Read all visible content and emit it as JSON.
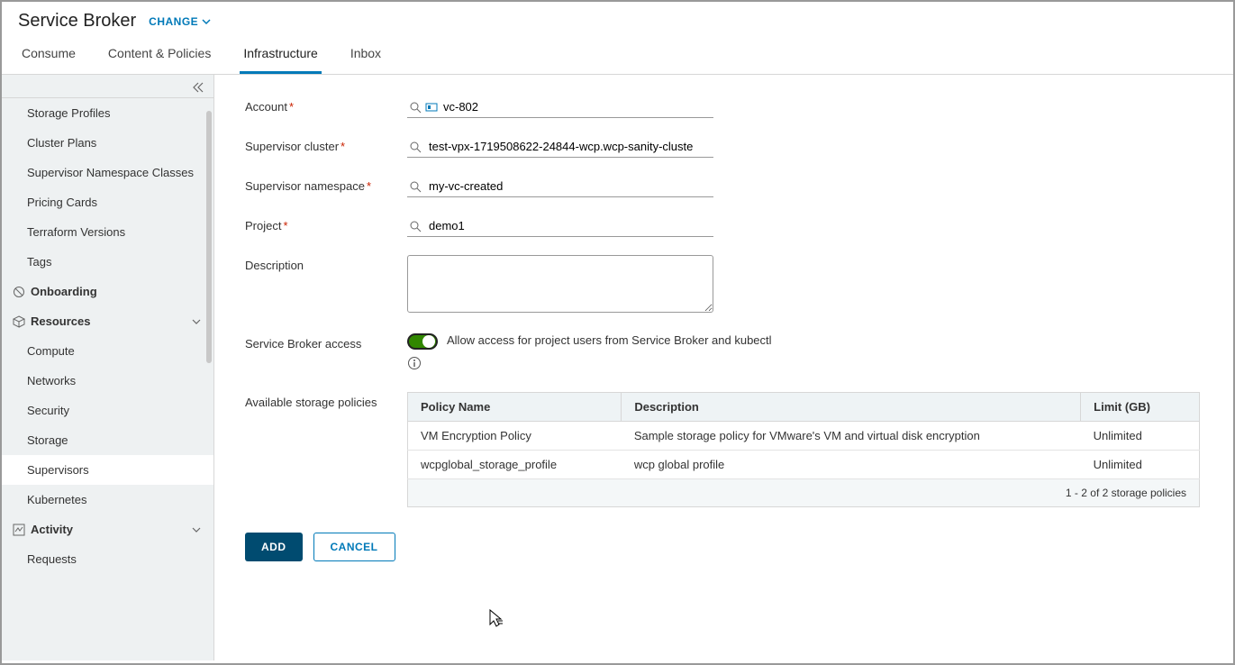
{
  "header": {
    "title": "Service Broker",
    "change": "CHANGE"
  },
  "tabs": {
    "consume": "Consume",
    "content": "Content & Policies",
    "infra": "Infrastructure",
    "inbox": "Inbox"
  },
  "sidebar": {
    "storage_profiles": "Storage Profiles",
    "cluster_plans": "Cluster Plans",
    "supervisor_ns_classes": "Supervisor Namespace Classes",
    "pricing_cards": "Pricing Cards",
    "terraform_versions": "Terraform Versions",
    "tags": "Tags",
    "onboarding": "Onboarding",
    "resources": "Resources",
    "compute": "Compute",
    "networks": "Networks",
    "security": "Security",
    "storage": "Storage",
    "supervisors": "Supervisors",
    "kubernetes": "Kubernetes",
    "activity": "Activity",
    "requests": "Requests"
  },
  "form": {
    "labels": {
      "account": "Account",
      "supervisor_cluster": "Supervisor cluster",
      "supervisor_namespace": "Supervisor namespace",
      "project": "Project",
      "description": "Description",
      "sb_access": "Service Broker access",
      "storage_policies": "Available storage policies"
    },
    "values": {
      "account": "vc-802",
      "supervisor_cluster": "test-vpx-1719508622-24844-wcp.wcp-sanity-cluste",
      "supervisor_namespace": "my-vc-created",
      "project": "demo1",
      "description": ""
    },
    "sb_access_text": "Allow access for project users from Service Broker and kubectl"
  },
  "table": {
    "headers": {
      "policy": "Policy Name",
      "desc": "Description",
      "limit": "Limit (GB)"
    },
    "rows": [
      {
        "policy": "VM Encryption Policy",
        "desc": "Sample storage policy for VMware's VM and virtual disk encryption",
        "limit": "Unlimited"
      },
      {
        "policy": "wcpglobal_storage_profile",
        "desc": "wcp global profile",
        "limit": "Unlimited"
      }
    ],
    "footer": "1 - 2 of 2 storage policies"
  },
  "buttons": {
    "add": "ADD",
    "cancel": "CANCEL"
  }
}
